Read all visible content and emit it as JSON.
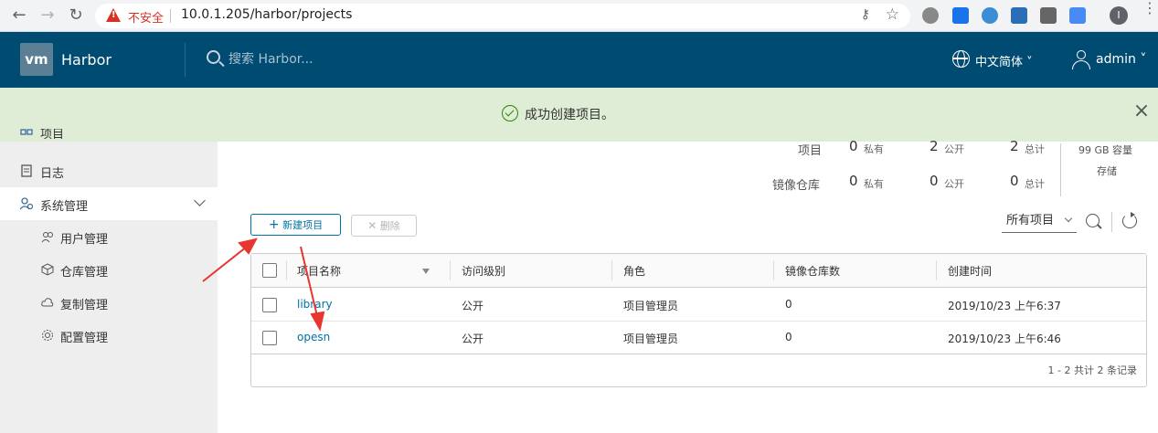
{
  "browser": {
    "insecure_label": "不安全",
    "url": "10.0.1.205/harbor/projects",
    "profile_initial": "I"
  },
  "header": {
    "brand": "Harbor",
    "logo_text": "vm",
    "search_placeholder": "搜索 Harbor...",
    "language": "中文简体",
    "username": "admin"
  },
  "banner": {
    "message": "成功创建项目。"
  },
  "sidebar": {
    "partial_top": "项目",
    "items": [
      {
        "label": "日志"
      },
      {
        "label": "系统管理"
      }
    ],
    "sub_items": [
      {
        "label": "用户管理"
      },
      {
        "label": "仓库管理"
      },
      {
        "label": "复制管理"
      },
      {
        "label": "配置管理"
      }
    ]
  },
  "stats": {
    "row_labels": [
      "项目",
      "镜像仓库"
    ],
    "projects": {
      "private": "0",
      "public": "2",
      "total": "2"
    },
    "repos": {
      "private": "0",
      "public": "0",
      "total": "0"
    },
    "units": {
      "private": "私有",
      "public": "公开",
      "total": "总计"
    },
    "storage": "99 GB 容量",
    "storage_label": "存储"
  },
  "toolbar": {
    "new_label": "新建项目",
    "delete_label": "删除",
    "filter_value": "所有项目"
  },
  "table": {
    "columns": [
      "项目名称",
      "访问级别",
      "角色",
      "镜像仓库数",
      "创建时间"
    ],
    "rows": [
      {
        "name": "library",
        "access": "公开",
        "role": "项目管理员",
        "repos": "0",
        "created": "2019/10/23 上午6:37"
      },
      {
        "name": "opesn",
        "access": "公开",
        "role": "项目管理员",
        "repos": "0",
        "created": "2019/10/23 上午6:46"
      }
    ],
    "footer": "1 - 2 共计 2 条记录"
  },
  "colors": {
    "header_bg": "#004b71",
    "banner_bg": "#dfedd6",
    "link": "#0072a3",
    "annotation_arrow": "#e8362e"
  }
}
